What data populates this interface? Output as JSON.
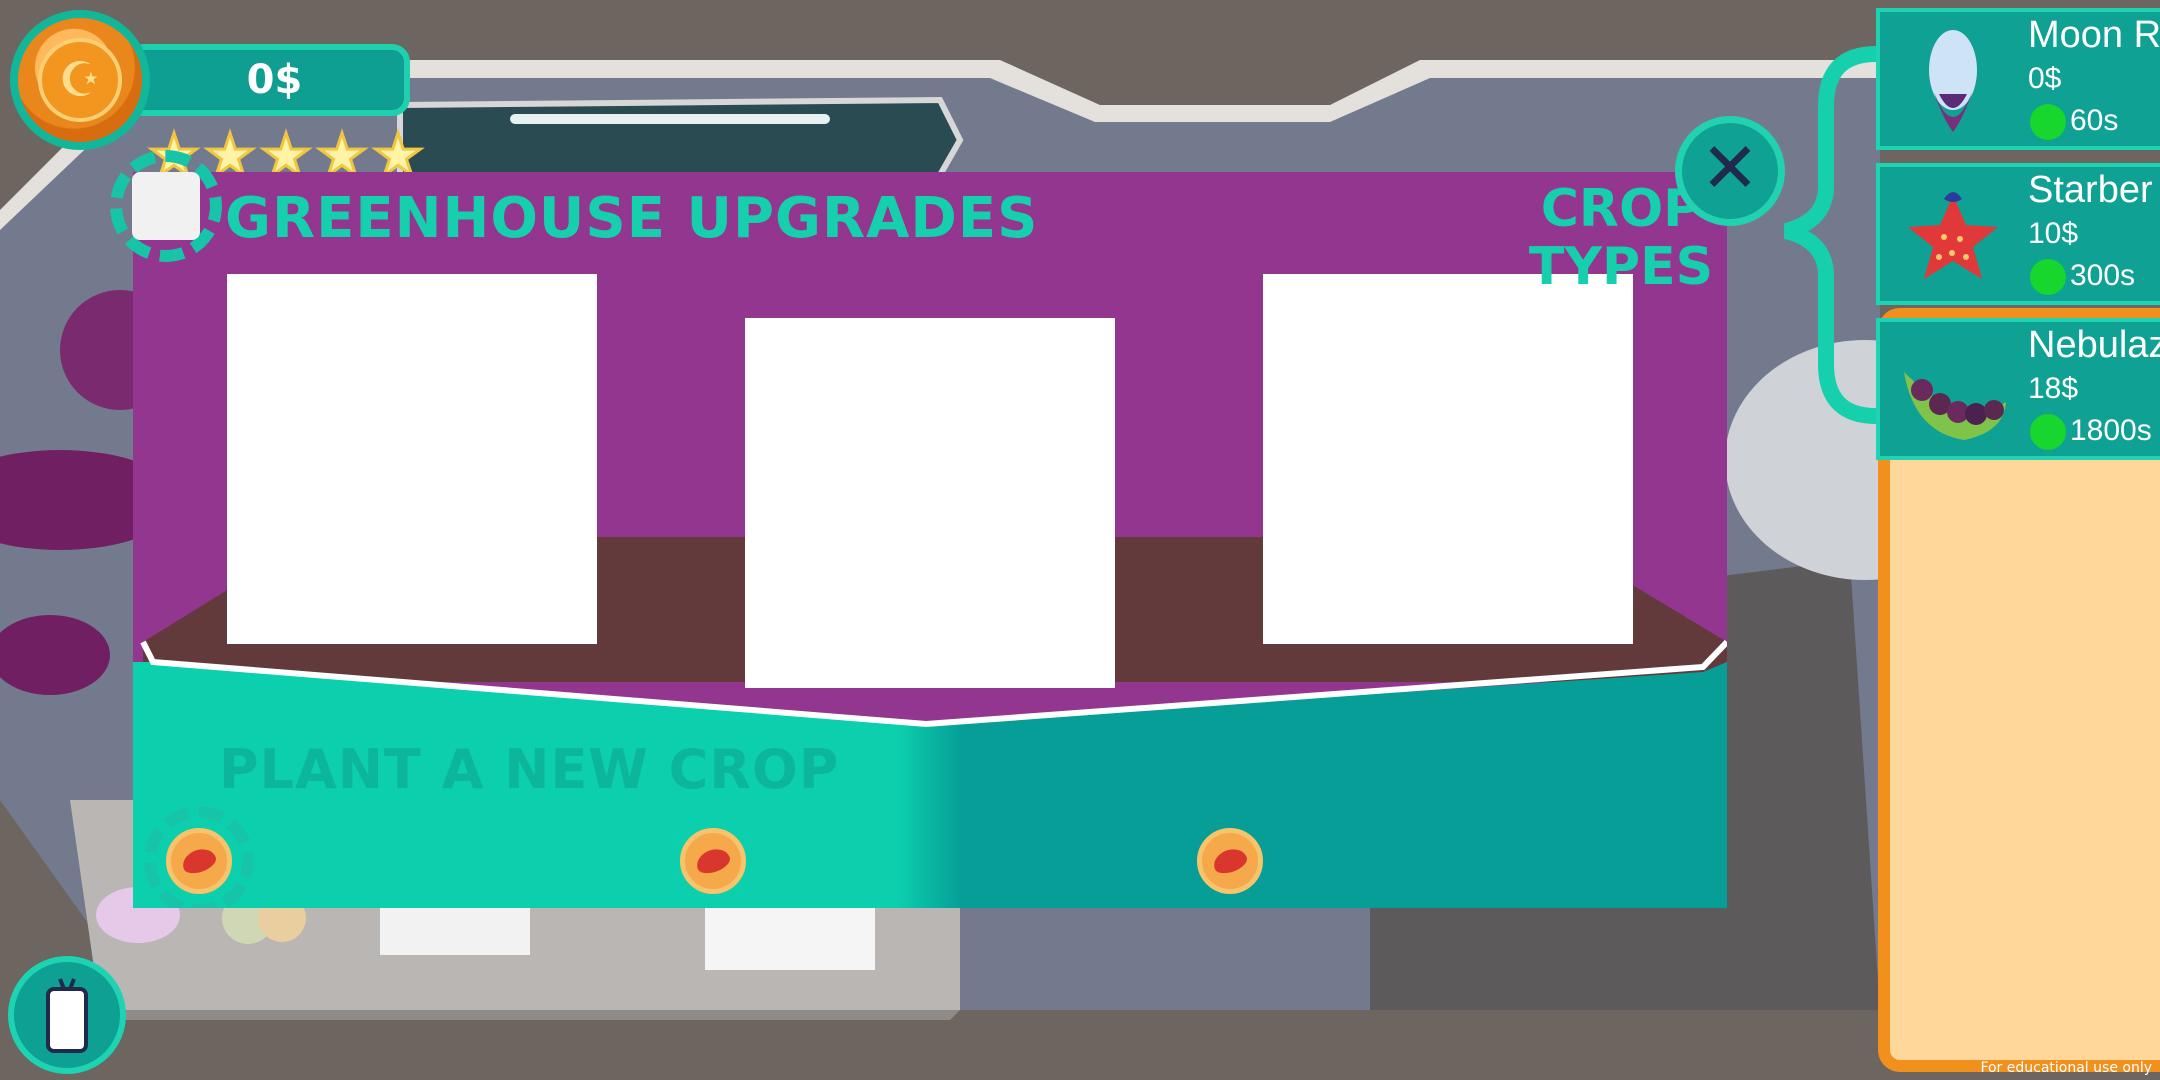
{
  "hud": {
    "money": "0$",
    "stars_count": 5
  },
  "panel": {
    "title": "GREENHOUSE UPGRADES",
    "crop_types_line1": "CROP",
    "crop_types_line2": "TYPES",
    "plant_label": "PLANT A NEW CROP"
  },
  "crops": [
    {
      "name": "Moon R",
      "price": "0$",
      "time": "60s",
      "icon": "moon-root-icon"
    },
    {
      "name": "Starber",
      "price": "10$",
      "time": "300s",
      "icon": "starberry-icon"
    },
    {
      "name": "Nebulaz",
      "price": "18$",
      "time": "1800s",
      "icon": "nebula-pea-icon"
    }
  ],
  "footer": {
    "note": "For educational use only"
  },
  "colors": {
    "accent": "#16cfad",
    "panel_purple": "#93368f",
    "panel_teal": "#0fa194",
    "soil": "#623a3c",
    "shop_bg": "#ffd79a",
    "shop_border": "#f2901d"
  }
}
